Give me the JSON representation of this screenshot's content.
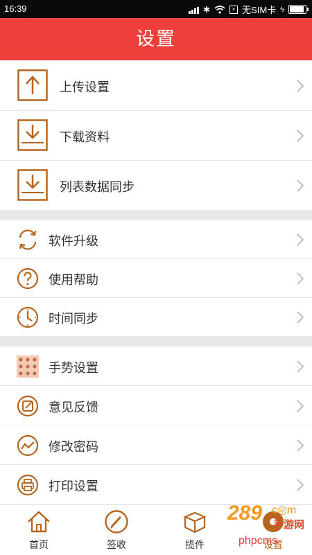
{
  "status_bar": {
    "time": "16:39",
    "carrier": "无SIM卡"
  },
  "header": {
    "title": "设置"
  },
  "group1": [
    {
      "label": "上传设置",
      "icon": "upload-icon"
    },
    {
      "label": "下载资料",
      "icon": "download-icon"
    },
    {
      "label": "列表数据同步",
      "icon": "download-icon"
    }
  ],
  "group2": [
    {
      "label": "软件升级",
      "icon": "refresh-icon"
    },
    {
      "label": "使用帮助",
      "icon": "help-icon"
    },
    {
      "label": "时间同步",
      "icon": "clock-icon"
    }
  ],
  "group3": [
    {
      "label": "手势设置",
      "icon": "gesture-grid-icon"
    },
    {
      "label": "意见反馈",
      "icon": "feedback-icon"
    },
    {
      "label": "修改密码",
      "icon": "password-icon"
    },
    {
      "label": "打印设置",
      "icon": "printer-icon"
    }
  ],
  "tabs": [
    {
      "label": "首页",
      "icon": "home-icon"
    },
    {
      "label": "签收",
      "icon": "sign-icon"
    },
    {
      "label": "揽件",
      "icon": "package-icon"
    },
    {
      "label": "设置",
      "icon": "settings-icon"
    }
  ],
  "watermark": {
    "brand": "289",
    "suffix": "手游网",
    "site": "phpcms"
  },
  "colors": {
    "accent": "#ef3f3a",
    "icon": "#b5651d"
  }
}
